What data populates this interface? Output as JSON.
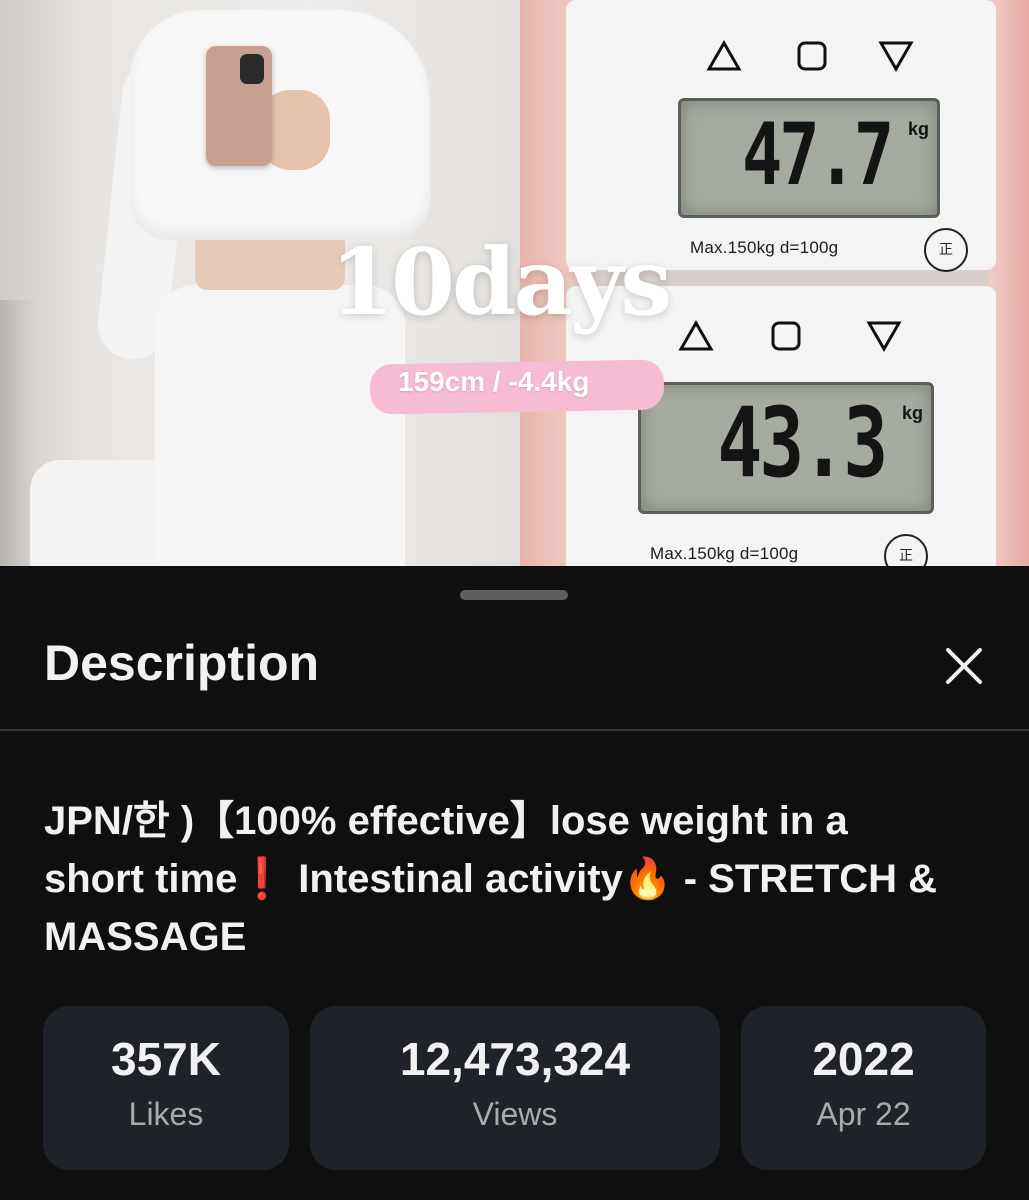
{
  "thumbnail": {
    "overlay_title": "10days",
    "overlay_subtitle": "159cm / -4.4kg",
    "scale_top": {
      "value": "47.7",
      "unit": "kg",
      "spec": "Max.150kg d=100g",
      "stamp": "正"
    },
    "scale_bottom": {
      "value": "43.3",
      "unit": "kg",
      "spec": "Max.150kg d=100g",
      "stamp": "正"
    },
    "pill_color": "#f6bcd3"
  },
  "sheet": {
    "title": "Description",
    "close_icon": "close-icon"
  },
  "video": {
    "title": "JPN/한 )【100% effective】lose weight in a short time❗ Intestinal activity🔥 - STRETCH & MASSAGE"
  },
  "stats": {
    "likes": {
      "value": "357K",
      "label": "Likes"
    },
    "views": {
      "value": "12,473,324",
      "label": "Views"
    },
    "date": {
      "value": "2022",
      "label": "Apr 22"
    }
  },
  "colors": {
    "background": "#0f0f0f",
    "card": "#1f2329",
    "text_primary": "#f1f1f1",
    "text_secondary": "#aaaaaa"
  }
}
